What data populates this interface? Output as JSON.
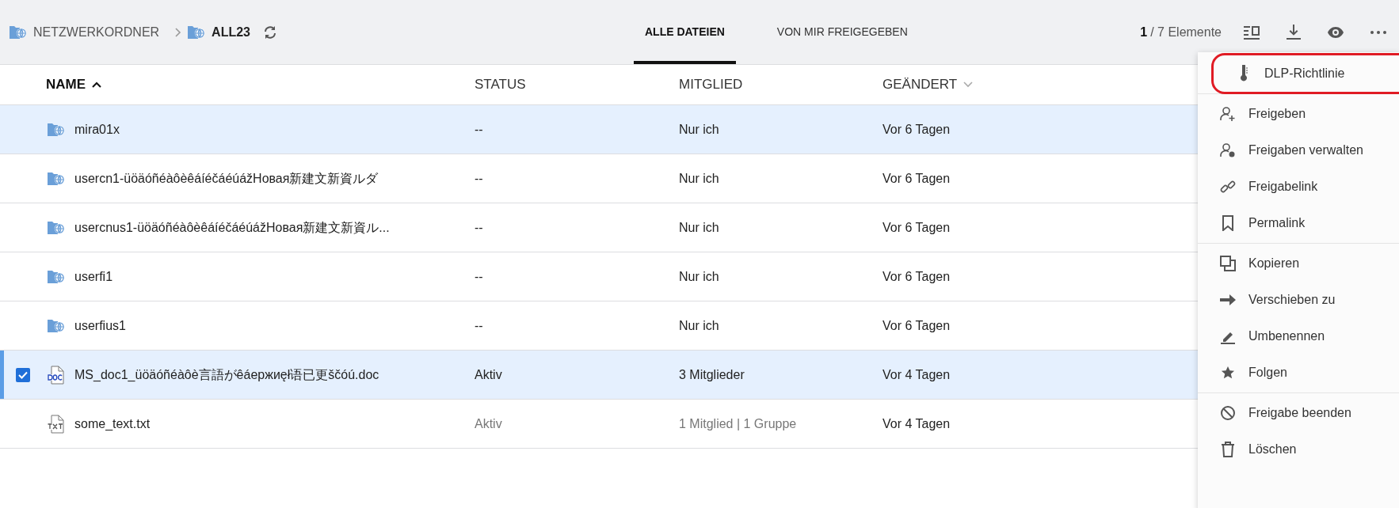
{
  "breadcrumb": [
    {
      "label": "NETZWERKORDNER",
      "current": false
    },
    {
      "label": "ALL23",
      "current": true
    }
  ],
  "tabs": [
    {
      "label": "ALLE DATEIEN",
      "selected": true
    },
    {
      "label": "VON MIR FREIGEGEBEN",
      "selected": false
    }
  ],
  "counter": {
    "selected": "1",
    "total": "/ 7 Elemente"
  },
  "table": {
    "columns": [
      {
        "label": "NAME",
        "sorted": true,
        "ascending": true
      },
      {
        "label": "STATUS",
        "sorted": false
      },
      {
        "label": "MITGLIED",
        "sorted": false
      },
      {
        "label": "GEÄNDERT",
        "sorted": false,
        "hint_arrow": true
      }
    ],
    "rows": [
      {
        "kind": "folder",
        "name": "mira01x",
        "status": "--",
        "member": "Nur ich",
        "changed": "Vor 6 Tagen",
        "highlighted": true,
        "selected": false
      },
      {
        "kind": "folder",
        "name": "usercn1-üöäóñéàôèêáíéčáéúážНовая新建文新資ルダ",
        "status": "--",
        "member": "Nur ich",
        "changed": "Vor 6 Tagen",
        "highlighted": false,
        "selected": false
      },
      {
        "kind": "folder",
        "name": "usercnus1-üöäóñéàôèêáíéčáéúážНовая新建文新資ル...",
        "status": "--",
        "member": "Nur ich",
        "changed": "Vor 6 Tagen",
        "highlighted": false,
        "selected": false
      },
      {
        "kind": "folder",
        "name": "userfi1",
        "status": "--",
        "member": "Nur ich",
        "changed": "Vor 6 Tagen",
        "highlighted": false,
        "selected": false
      },
      {
        "kind": "folder",
        "name": "userfius1",
        "status": "--",
        "member": "Nur ich",
        "changed": "Vor 6 Tagen",
        "highlighted": false,
        "selected": false
      },
      {
        "kind": "doc",
        "name": "MS_doc1_üöäóñéàôè言語がêáержиęł语已更ščóú.doc",
        "status": "Aktiv",
        "member": "3 Mitglieder",
        "changed": "Vor 4 Tagen",
        "highlighted": true,
        "selected": true
      },
      {
        "kind": "txt",
        "name": "some_text.txt",
        "status": "Aktiv",
        "member": "1 Mitglied | 1 Gruppe",
        "changed": "Vor 4 Tagen",
        "highlighted": false,
        "selected": false
      }
    ]
  },
  "menu": {
    "groups": [
      [
        {
          "label": "DLP-Richtlinie",
          "circled": true
        }
      ],
      [
        {
          "label": "Freigeben",
          "circled": false
        },
        {
          "label": "Freigaben verwalten",
          "circled": false
        },
        {
          "label": "Freigabelink",
          "circled": false
        },
        {
          "label": "Permalink",
          "circled": false
        }
      ],
      [
        {
          "label": "Kopieren",
          "circled": false
        },
        {
          "label": "Verschieben zu",
          "circled": false
        },
        {
          "label": "Umbenennen",
          "circled": false
        },
        {
          "label": "Folgen",
          "circled": false
        }
      ],
      [
        {
          "label": "Freigabe beenden",
          "circled": false
        },
        {
          "label": "Löschen",
          "circled": false
        }
      ]
    ]
  }
}
